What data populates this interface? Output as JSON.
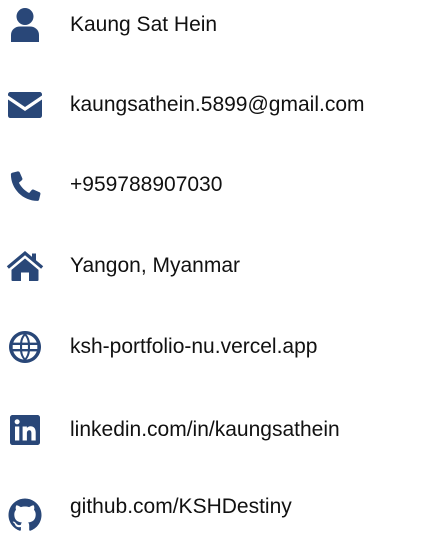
{
  "theme": {
    "icon_color": "#294778",
    "text_color": "#111111",
    "background": "#ffffff"
  },
  "contacts": [
    {
      "icon": "user-icon",
      "label": "Kaung Sat Hein"
    },
    {
      "icon": "envelope-icon",
      "label": "kaungsathein.5899@gmail.com"
    },
    {
      "icon": "phone-icon",
      "label": "+959788907030"
    },
    {
      "icon": "home-icon",
      "label": "Yangon, Myanmar"
    },
    {
      "icon": "globe-icon",
      "label": "ksh-portfolio-nu.vercel.app"
    },
    {
      "icon": "linkedin-icon",
      "label": "linkedin.com/in/kaungsathein"
    },
    {
      "icon": "github-icon",
      "label": "github.com/KSHDestiny"
    }
  ]
}
